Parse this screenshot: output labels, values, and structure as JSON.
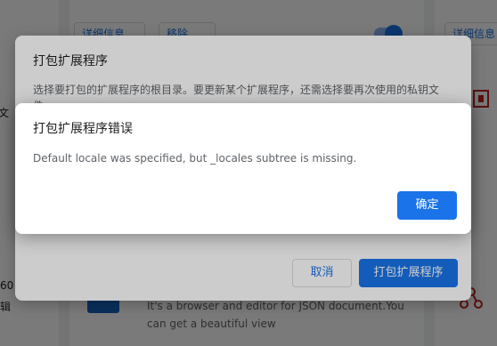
{
  "background": {
    "details_button": "详细信息",
    "remove_button": "移除",
    "details_button_right": "详细信息",
    "left_text_top": "文",
    "left_text_num": "60",
    "left_text_bottom": "辑",
    "ext_desc_line1": "It's a browser and editor for JSON document.You",
    "ext_desc_line2": "can get a beautiful view"
  },
  "pack_dialog": {
    "title": "打包扩展程序",
    "body": "选择要打包的扩展程序的根目录。要更新某个扩展程序，还需选择要再次使用的私钥文件。",
    "cancel_label": "取消",
    "pack_label": "打包扩展程序"
  },
  "error_dialog": {
    "title": "打包扩展程序错误",
    "message": "Default locale was specified, but _locales subtree is missing.",
    "ok_label": "确定"
  },
  "colors": {
    "accent": "#1a73e8",
    "error_icon": "#c5221f"
  }
}
